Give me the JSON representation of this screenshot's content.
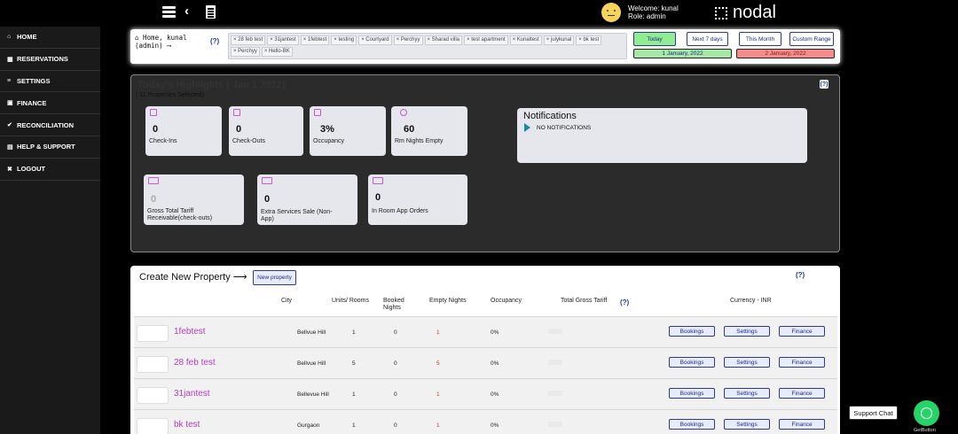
{
  "header": {
    "welcome": "Welcome: kunal",
    "role": "Role: admin",
    "logo": "nodal"
  },
  "sidebar": {
    "items": [
      {
        "label": "HOME",
        "icon": "home-icon",
        "glyph": "⌂"
      },
      {
        "label": "RESERVATIONS",
        "icon": "calendar-icon",
        "glyph": "▦"
      },
      {
        "label": "SETTINGS",
        "icon": "sliders-icon",
        "glyph": "≡"
      },
      {
        "label": "FINANCE",
        "icon": "money-icon",
        "glyph": "▣"
      },
      {
        "label": "RECONCILIATION",
        "icon": "check-icon",
        "glyph": "✔"
      },
      {
        "label": "HELP & SUPPORT",
        "icon": "book-icon",
        "glyph": "▤"
      },
      {
        "label": "LOGOUT",
        "icon": "close-icon",
        "glyph": "✖"
      }
    ]
  },
  "breadcrumb": {
    "home_line1": "Home, kunal",
    "home_line2": "(admin) ⟶",
    "help": "(?)",
    "tags": [
      "28 feb test",
      "31jantest",
      "1febtest",
      "testing",
      "Courtyard",
      "Perchyy",
      "Sharad villa",
      "test apartment",
      "Kunaltest",
      "julykunal",
      "bk test",
      "Perchyy",
      "Hello-BK"
    ]
  },
  "date_filter": {
    "today": "Today",
    "next7": "Next 7 days",
    "this_month": "This Month",
    "custom": "Custom Range",
    "from": "1 January, 2022",
    "to": "2 January, 2022"
  },
  "highlights": {
    "title": "Today's Highlights ( Jan 1 2022)",
    "subtitle": "( 11 Properties Selected)",
    "help": "(?)",
    "stats": [
      {
        "value": "0",
        "label": "Check-Ins"
      },
      {
        "value": "0",
        "label": "Check-Outs"
      },
      {
        "value": "3%",
        "label": "Occupancy"
      },
      {
        "value": "60",
        "label": "Rm Nights Empty"
      },
      {
        "value": "0",
        "label": "Gross Total Tariff Receivable(check-outs)"
      },
      {
        "value": "0",
        "label": "Extra Services Sale (Non-App)"
      },
      {
        "value": "0",
        "label": "In Room App Orders"
      }
    ],
    "notifications_title": "Notifications",
    "notifications_message": "NO NOTIFICATIONS"
  },
  "properties": {
    "title": "Create New Property ⟶",
    "new_button": "New property",
    "help": "(?)",
    "columns": {
      "city": "City",
      "units": "Units/ Rooms",
      "booked": "Booked Nights",
      "empty": "Empty Nights",
      "occupancy": "Occupancy",
      "tariff": "Total Gross Tariff",
      "tariff_help": "(?)",
      "currency": "Currency - INR"
    },
    "rows": [
      {
        "name": "1febtest",
        "city": "Bellvue Hill",
        "units": "1",
        "booked": "0",
        "empty": "1",
        "occupancy": "0%"
      },
      {
        "name": "28 feb test",
        "city": "Bellvue Hill",
        "units": "5",
        "booked": "0",
        "empty": "5",
        "occupancy": "0%"
      },
      {
        "name": "31jantest",
        "city": "Bellevue Hill",
        "units": "1",
        "booked": "0",
        "empty": "1",
        "occupancy": "0%"
      },
      {
        "name": "bk test",
        "city": "Gurgaon",
        "units": "1",
        "booked": "0",
        "empty": "1",
        "occupancy": "0%"
      }
    ],
    "row_buttons": {
      "bookings": "Bookings",
      "settings": "Settings",
      "finance": "Finance"
    }
  },
  "support": {
    "chat_label": "Support Chat",
    "brand": "GetButton"
  }
}
